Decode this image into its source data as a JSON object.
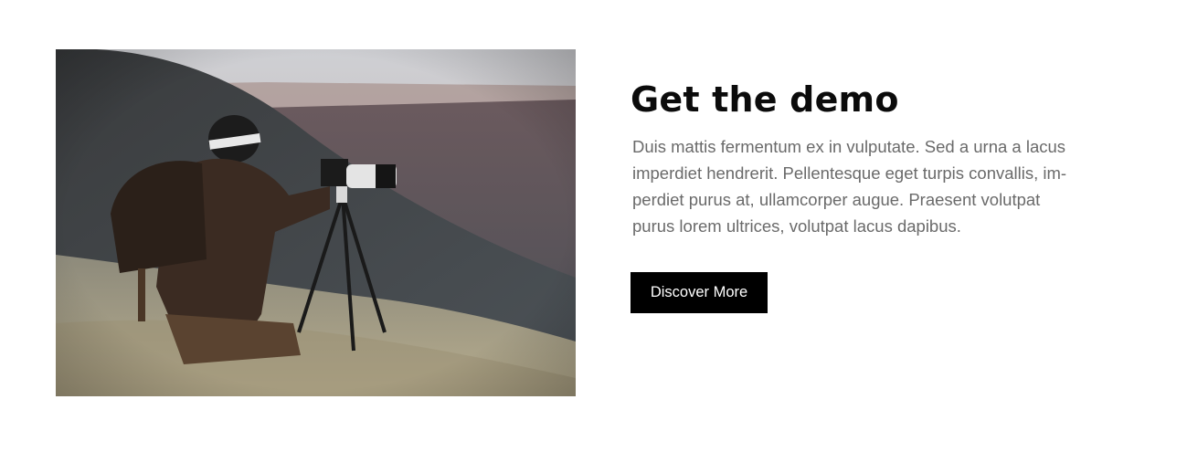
{
  "hero": {
    "image_icon": "photographer-image",
    "title": "Get the demo",
    "body_lines": [
      "Duis mattis fermentum ex in vulputate. Sed a urna a lacus",
      "imperdiet hendrerit. Pellentesque eget turpis convallis, im-",
      "perdiet purus at, ullamcorper augue. Praesent volutpat",
      "purus lorem ultrices, volutpat lacus dapibus."
    ],
    "cta_label": "Discover More"
  },
  "colors": {
    "background": "#ffffff",
    "title": "#0b0b0b",
    "body": "#6a6a6a",
    "button_bg": "#000000",
    "button_text": "#ffffff"
  }
}
